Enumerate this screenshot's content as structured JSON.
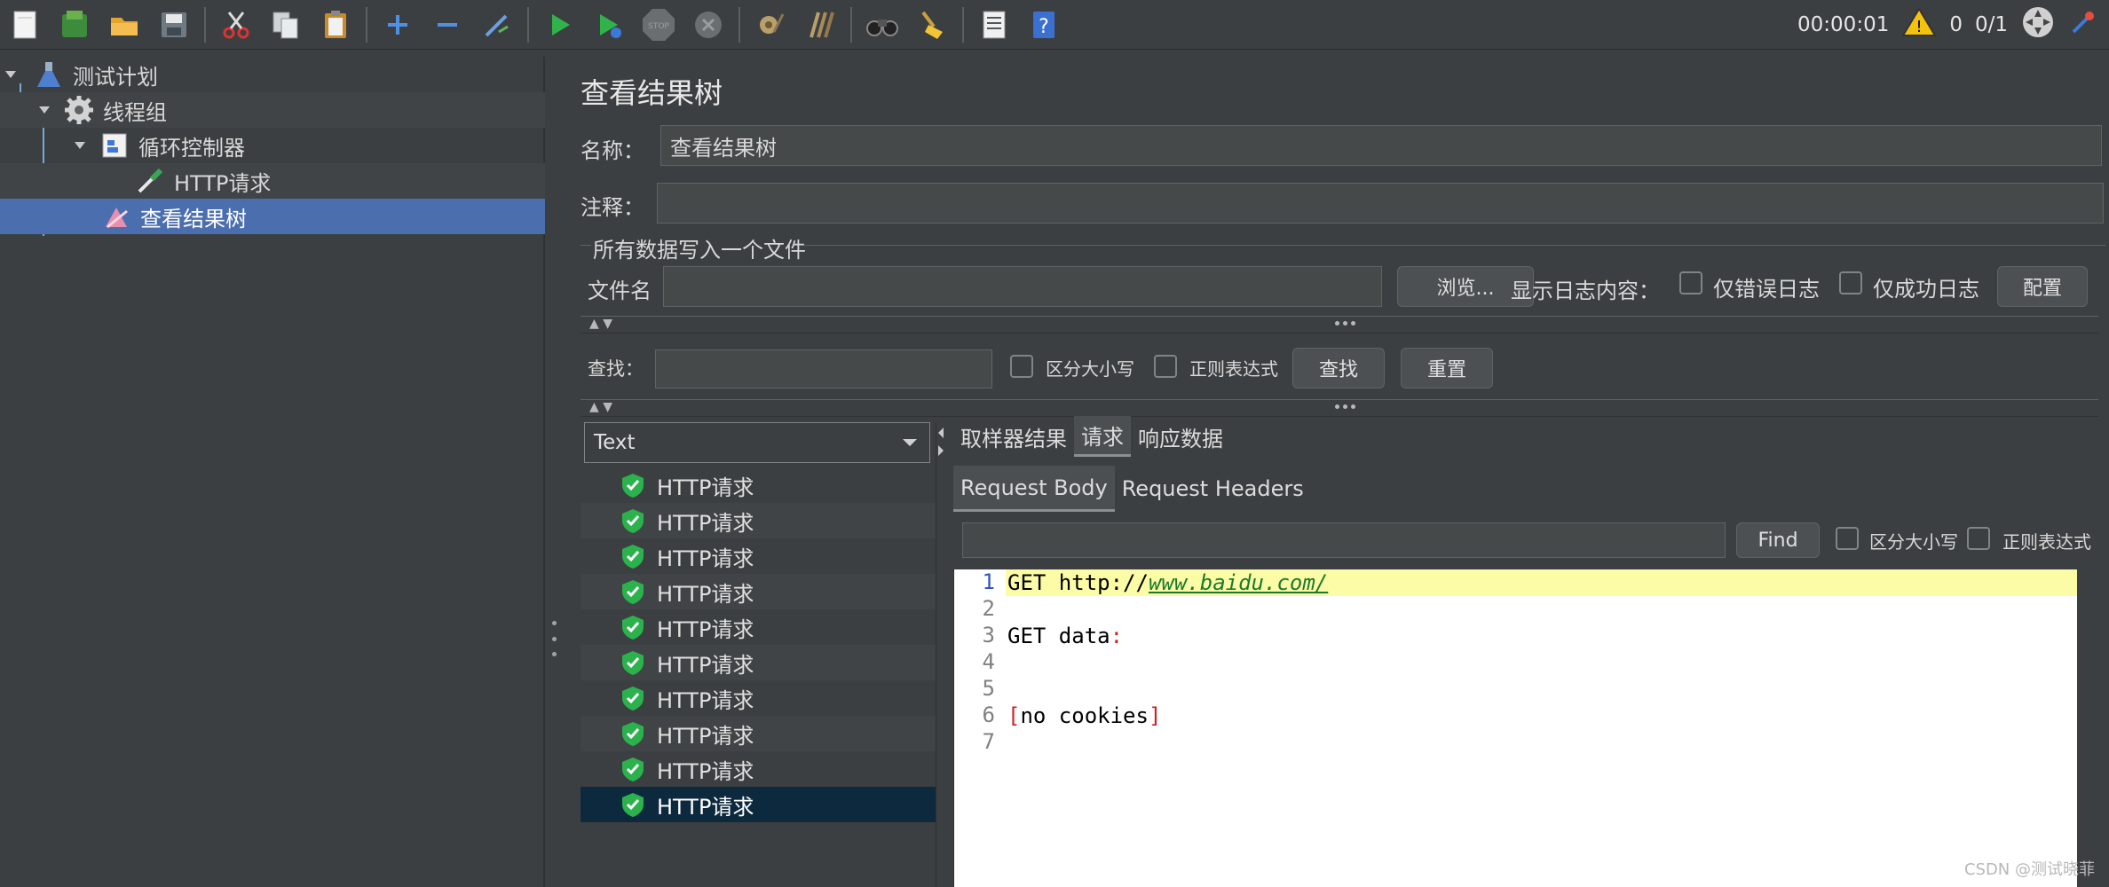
{
  "toolbar": {
    "timer": "00:00:01",
    "warnings": "0",
    "threads": "0/1",
    "icons": [
      "new-icon",
      "templates-icon",
      "open-icon",
      "save-icon",
      "cut-icon",
      "copy-icon",
      "paste-icon",
      "add-icon",
      "remove-icon",
      "wand-icon",
      "start-icon",
      "start-no-pause-icon",
      "stop-icon",
      "shutdown-icon",
      "clear-icon",
      "clear-all-icon",
      "search-binoculars-icon",
      "reset-broom-icon",
      "function-helper-icon",
      "help-icon"
    ]
  },
  "tree": {
    "items": [
      {
        "label": "测试计划"
      },
      {
        "label": "线程组"
      },
      {
        "label": "循环控制器"
      },
      {
        "label": "HTTP请求"
      },
      {
        "label": "查看结果树"
      }
    ]
  },
  "panel": {
    "title": "查看结果树",
    "name_label": "名称：",
    "name_value": "查看结果树",
    "comment_label": "注释：",
    "comment_value": "",
    "file_group_title": "所有数据写入一个文件",
    "filename_label": "文件名",
    "filename_value": "",
    "browse_label": "浏览...",
    "log_label": "显示日志内容：",
    "errors_only_label": "仅错误日志",
    "success_only_label": "仅成功日志",
    "config_label": "配置",
    "search_label": "查找：",
    "search_value": "",
    "case_label": "区分大小写",
    "regex_label": "正则表达式",
    "find_label": "查找",
    "reset_label": "重置"
  },
  "results": {
    "renderer": "Text",
    "items": [
      "HTTP请求",
      "HTTP请求",
      "HTTP请求",
      "HTTP请求",
      "HTTP请求",
      "HTTP请求",
      "HTTP请求",
      "HTTP请求",
      "HTTP请求",
      "HTTP请求"
    ]
  },
  "detail": {
    "tabs": [
      "取样器结果",
      "请求",
      "响应数据"
    ],
    "subtabs": [
      "Request Body",
      "Request Headers"
    ],
    "find_label": "Find",
    "find_value": "",
    "case_label": "区分大小写",
    "regex_label": "正则表达式",
    "line_numbers": [
      "1",
      "2",
      "3",
      "4",
      "5",
      "6",
      "7"
    ],
    "code": {
      "line1_prefix": "GET http://",
      "line1_url": "www.baidu.com/",
      "line3_prefix": "GET data",
      "line3_colon": ":",
      "line6_open": "[",
      "line6_text": "no cookies",
      "line6_close": "]"
    }
  },
  "watermark": "CSDN @测试晓菲"
}
